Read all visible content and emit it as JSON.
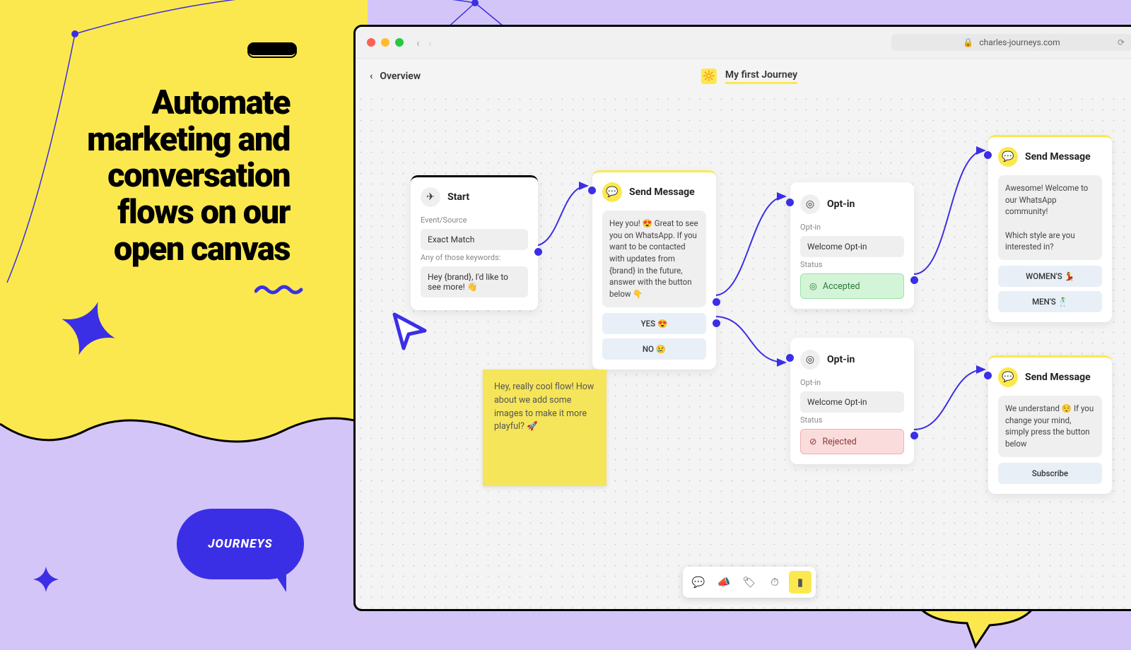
{
  "marketing": {
    "headline": "Automate marketing and conversation flows on our open canvas",
    "bubble_label": "JOURNEYS"
  },
  "browser": {
    "url": "charles-journeys.com",
    "overview_label": "Overview",
    "journey_name": "My first Journey",
    "journey_emoji": "🔆"
  },
  "nodes": {
    "start": {
      "title": "Start",
      "label_source": "Event/Source",
      "source_value": "Exact Match",
      "label_keywords": "Any of those keywords:",
      "keywords_value": "Hey {brand}, I'd like to see more! 👋"
    },
    "msg1": {
      "title": "Send Message",
      "body": "Hey you! 😍 Great to see you on WhatsApp. If you want to be contacted with updates from {brand} in the future, answer with the button below 👇",
      "btn_yes": "YES 😍",
      "btn_no": "NO 😢"
    },
    "optin1": {
      "title": "Opt-in",
      "label_optin": "Opt-in",
      "optin_value": "Welcome Opt-in",
      "label_status": "Status",
      "status_value": "Accepted"
    },
    "optin2": {
      "title": "Opt-in",
      "label_optin": "Opt-in",
      "optin_value": "Welcome Opt-in",
      "label_status": "Status",
      "status_value": "Rejected"
    },
    "msg2": {
      "title": "Send Message",
      "body": "Awesome! Welcome to our WhatsApp community!\n\nWhich style are you interested in?",
      "btn_women": "WOMEN'S 💃",
      "btn_men": "MEN'S 🕺"
    },
    "msg3": {
      "title": "Send Message",
      "body": "We understand 😌 If you change your mind, simply press the button below",
      "btn_sub": "Subscribe"
    },
    "sticky": {
      "text": "Hey, really cool flow! How about we add some images to make it more playful? 🚀"
    }
  }
}
